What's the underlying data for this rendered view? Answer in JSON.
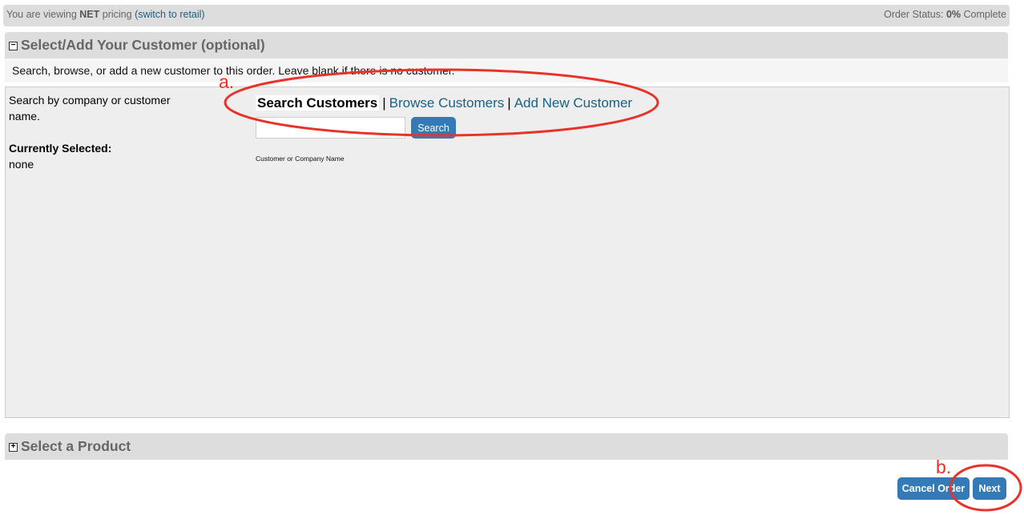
{
  "topbar": {
    "viewing_prefix": "You are viewing ",
    "pricing_type": "NET",
    "viewing_suffix": " pricing ",
    "switch_link": "(switch to retail)",
    "status_prefix": "Order Status: ",
    "status_percent": "0%",
    "status_suffix": " Complete"
  },
  "customer_section": {
    "title": "Select/Add Your Customer (optional)",
    "toggle_symbol": "−",
    "description": "Search, browse, or add a new customer to this order. Leave blank if there is no customer.",
    "help_text": "Search by company or customer name.",
    "currently_selected_label": "Currently Selected:",
    "currently_selected_value": "none",
    "tabs": {
      "search": "Search Customers",
      "browse": "Browse Customers",
      "add": "Add New Customer",
      "separator": "|"
    },
    "search": {
      "value": "",
      "placeholder": "",
      "button_label": "Search",
      "field_label": "Customer or Company Name"
    }
  },
  "product_section": {
    "title": "Select a Product",
    "toggle_symbol": "+"
  },
  "footer": {
    "cancel_label": "Cancel Order",
    "next_label": "Next"
  },
  "annotations": {
    "a_label": "a.",
    "b_label": "b.",
    "color": "#e8332a"
  }
}
